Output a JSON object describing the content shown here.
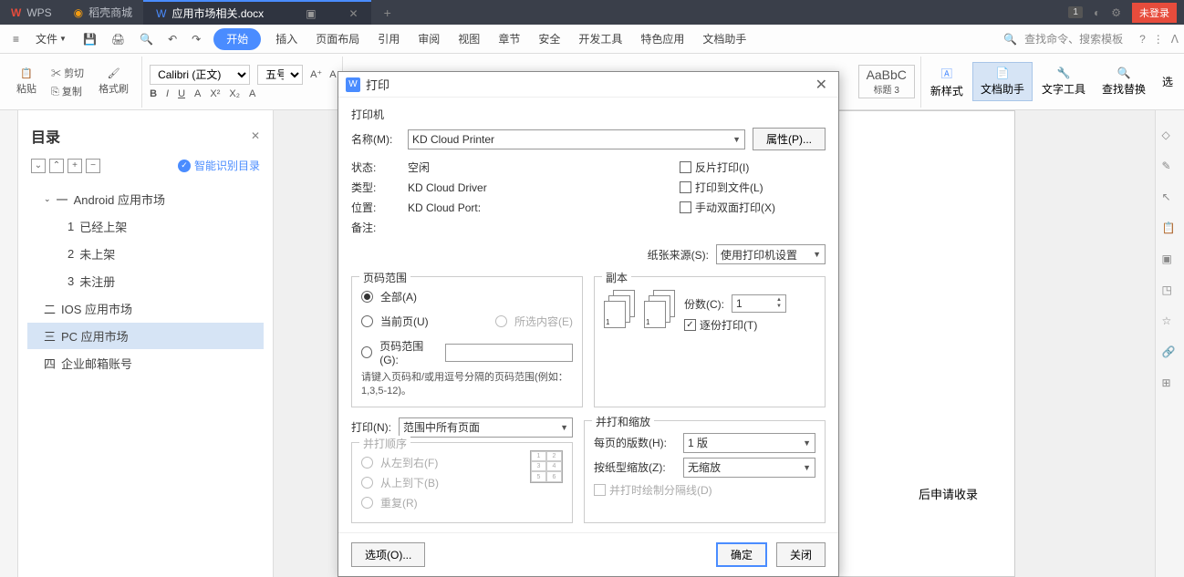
{
  "titlebar": {
    "wps": "WPS",
    "store": "稻壳商城",
    "doc": "应用市场相关.docx",
    "badge": "1",
    "login": "未登录"
  },
  "menubar": {
    "file": "文件",
    "items": [
      "开始",
      "插入",
      "页面布局",
      "引用",
      "审阅",
      "视图",
      "章节",
      "安全",
      "开发工具",
      "特色应用",
      "文档助手"
    ],
    "search_hint": "查找命令、搜索模板"
  },
  "toolbar": {
    "cut": "剪切",
    "paste": "粘贴",
    "copy": "复制",
    "format_brush": "格式刷",
    "font_name": "Calibri (正文)",
    "font_size": "五号",
    "style_preview": "AaBbC",
    "heading3": "标题 3",
    "new_style": "新样式",
    "doc_helper": "文档助手",
    "text_tools": "文字工具",
    "find_replace": "查找替换",
    "select": "选"
  },
  "sidebar": {
    "title": "目录",
    "smart": "智能识别目录",
    "items": [
      {
        "label": "Android 应用市场",
        "prefix": "一",
        "level": 1,
        "expanded": true
      },
      {
        "label": "已经上架",
        "prefix": "1",
        "level": 2
      },
      {
        "label": "未上架",
        "prefix": "2",
        "level": 2
      },
      {
        "label": "未注册",
        "prefix": "3",
        "level": 2
      },
      {
        "label": "IOS 应用市场",
        "prefix": "二",
        "level": 1
      },
      {
        "label": "PC 应用市场",
        "prefix": "三",
        "level": 1,
        "selected": true
      },
      {
        "label": "企业邮箱账号",
        "prefix": "四",
        "level": 1
      }
    ]
  },
  "doc_text": "后申请收录",
  "dialog": {
    "title": "打印",
    "printer_section": "打印机",
    "name_label": "名称(M):",
    "name_value": "KD Cloud Printer",
    "properties": "属性(P)...",
    "status_label": "状态:",
    "status_value": "空闲",
    "type_label": "类型:",
    "type_value": "KD Cloud Driver",
    "location_label": "位置:",
    "location_value": "KD Cloud Port:",
    "remarks_label": "备注:",
    "reverse_print": "反片打印(I)",
    "print_to_file": "打印到文件(L)",
    "manual_duplex": "手动双面打印(X)",
    "paper_source_label": "纸张来源(S):",
    "paper_source_value": "使用打印机设置",
    "page_range_section": "页码范围",
    "range_all": "全部(A)",
    "range_current": "当前页(U)",
    "range_selection": "所选内容(E)",
    "range_pages": "页码范围(G):",
    "range_hint": "请键入页码和/或用逗号分隔的页码范围(例如：1,3,5-12)。",
    "copies_section": "副本",
    "copies_label": "份数(C):",
    "copies_value": "1",
    "collate": "逐份打印(T)",
    "print_what_label": "打印(N):",
    "print_what_value": "范围中所有页面",
    "nup_order_section": "并打顺序",
    "nup_ltr": "从左到右(F)",
    "nup_ttb": "从上到下(B)",
    "nup_repeat": "重复(R)",
    "nup_scale_section": "并打和缩放",
    "pages_per_sheet_label": "每页的版数(H):",
    "pages_per_sheet_value": "1 版",
    "scale_label": "按纸型缩放(Z):",
    "scale_value": "无缩放",
    "draw_separators": "并打时绘制分隔线(D)",
    "options": "选项(O)...",
    "ok": "确定",
    "close": "关闭"
  }
}
